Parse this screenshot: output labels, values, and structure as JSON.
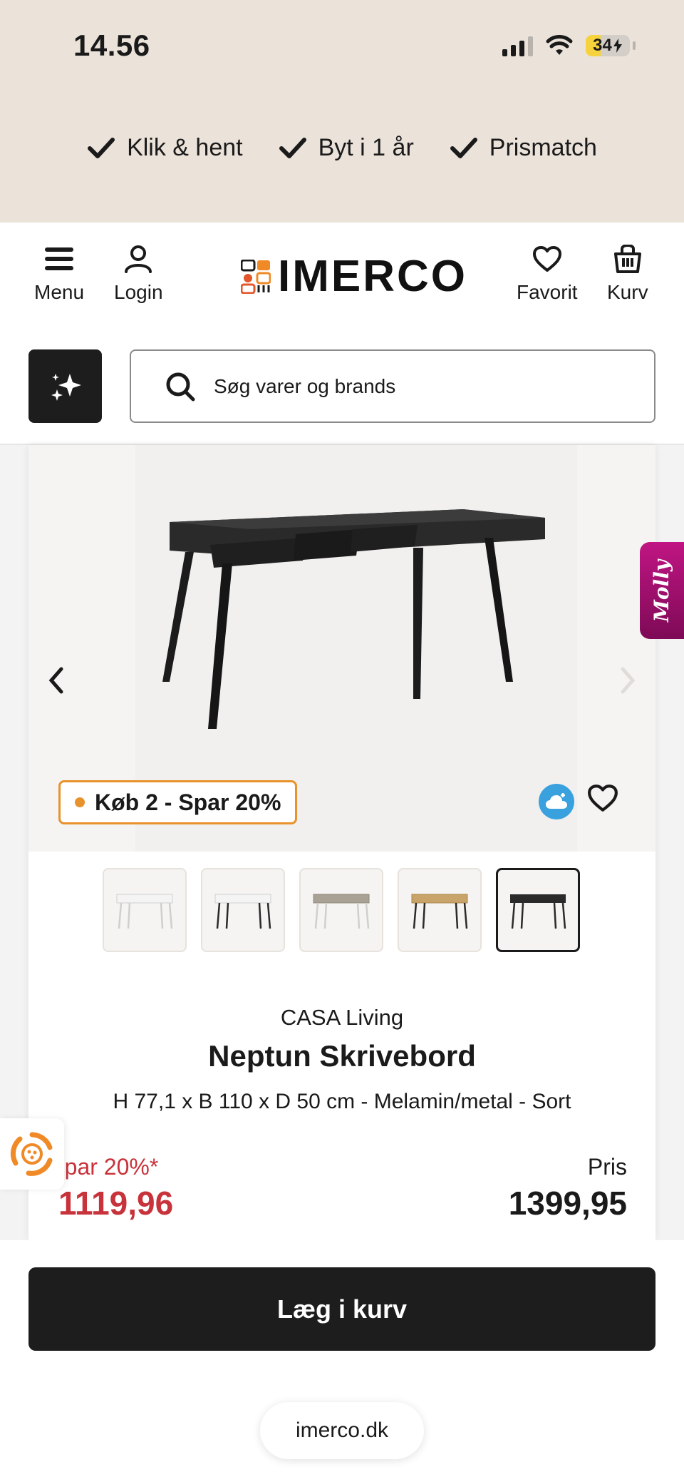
{
  "status_bar": {
    "time": "14.56",
    "battery": "34",
    "battery_fraction": 0.34
  },
  "perks": [
    {
      "label": "Klik & hent",
      "icon": "check-icon"
    },
    {
      "label": "Byt i 1 år",
      "icon": "check-icon"
    },
    {
      "label": "Prismatch",
      "icon": "check-icon"
    }
  ],
  "header": {
    "menu_label": "Menu",
    "login_label": "Login",
    "logo_text": "IMERCO",
    "favorite_label": "Favorit",
    "cart_label": "Kurv"
  },
  "search": {
    "placeholder": "Søg varer og brands"
  },
  "product": {
    "promo": "Køb 2 - Spar 20%",
    "brand": "CASA Living",
    "title": "Neptun Skrivebord",
    "spec": "H 77,1 x B 110 x D 50 cm - Melamin/metal - Sort",
    "save_label": "ˌpar 20%*",
    "sale_price": "1119,96",
    "price_label": "Pris",
    "price": "1399,95",
    "thumbnails": [
      {
        "variant": "white",
        "selected": false
      },
      {
        "variant": "white-black-legs",
        "selected": false
      },
      {
        "variant": "grey-white-legs",
        "selected": false
      },
      {
        "variant": "oak-black-legs",
        "selected": false
      },
      {
        "variant": "black",
        "selected": true
      }
    ]
  },
  "chat_widget": {
    "label": "Molly"
  },
  "cta": {
    "add_to_cart": "Læg i kurv"
  },
  "browser": {
    "url": "imerco.dk"
  },
  "colors": {
    "accent_orange": "#e8922c",
    "sale_red": "#c8323a",
    "dark": "#1d1d1d",
    "top_band": "#ebe3da"
  }
}
